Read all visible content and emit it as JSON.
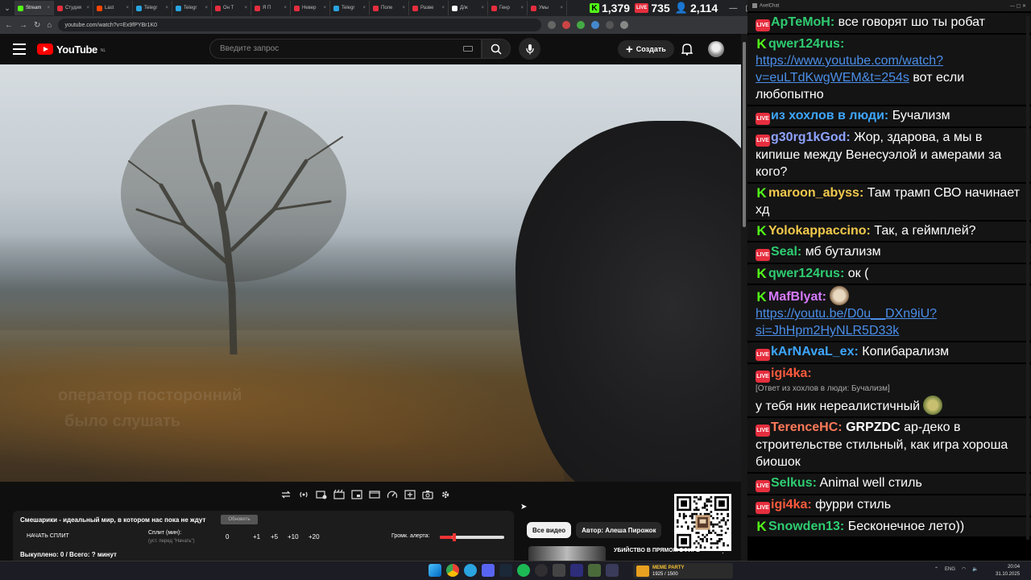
{
  "browser": {
    "tabs": [
      {
        "label": "Stream",
        "color": "#53fc18"
      },
      {
        "label": "Студия",
        "color": "#e62e3e"
      },
      {
        "label": "Last",
        "color": "#ff4500"
      },
      {
        "label": "Telegr",
        "color": "#2aa4e0"
      },
      {
        "label": "Telegr",
        "color": "#2aa4e0"
      },
      {
        "label": "Он Т",
        "color": "#e62e3e"
      },
      {
        "label": "Я П",
        "color": "#e62e3e"
      },
      {
        "label": "Невер",
        "color": "#e62e3e"
      },
      {
        "label": "Telegr",
        "color": "#2aa4e0"
      },
      {
        "label": "Поле",
        "color": "#e62e3e"
      },
      {
        "label": "Разве",
        "color": "#e62e3e"
      },
      {
        "label": "Д/ж",
        "color": "#ffffff"
      },
      {
        "label": "Генр",
        "color": "#e62e3e"
      },
      {
        "label": "Умы",
        "color": "#e62e3e"
      }
    ],
    "url": "youtube.com/watch?v=Ex9fPYBr1K0"
  },
  "stats": {
    "kick_viewers": "1,379",
    "youtube_viewers": "735",
    "total_viewers": "2,114"
  },
  "youtube": {
    "region": "NL",
    "logo": "YouTube",
    "search_placeholder": "Введите запрос",
    "create_label": "Создать"
  },
  "panel": {
    "title": "Смешарики - идеальный мир, в котором нас пока не ждут",
    "refresh": "Обновить",
    "start_split": "НАЧАТЬ СПЛИТ",
    "split_label": "Сплит (мин):",
    "split_hint": "(уст. перед \"Начать\")",
    "split_value": "0",
    "increments": [
      "+1",
      "+5",
      "+10",
      "+20"
    ],
    "alert_volume_label": "Громк. алерта:",
    "alert_volume": 0.2,
    "bought": "Выкуплено: 0 / Всего: ? минут"
  },
  "video_overlay": {
    "line1": "оператор посторонний",
    "line2": "было слушать"
  },
  "filters": {
    "all": "Все видео",
    "author": "Автор: Алеша Пирожок"
  },
  "recommendation": {
    "title": "УБИЙСТВО В ПРЯМОМ ЭФИРЕ"
  },
  "chat": {
    "window_title": "AxelChat",
    "messages": [
      {
        "src": "yt",
        "nick": "АрТеМоН:",
        "color": "#2ecc71",
        "text": "все говорят шо ты робат"
      },
      {
        "src": "kick",
        "nick": "qwer124rus:",
        "color": "#2ecc71",
        "link": "https://www.youtube.com/watch?v=euLTdKwgWEM&t=254s",
        "text": "вот если любопытно"
      },
      {
        "src": "yt",
        "nick": "из хохлов в люди:",
        "color": "#3ea6ff",
        "text": "Бучализм"
      },
      {
        "src": "yt",
        "nick": "g30rg1kGod:",
        "color": "#8fa3ff",
        "text": "Жор, здарова, а мы в кипише между Венесуэлой и амерами за кого?"
      },
      {
        "src": "kick",
        "nick": "maroon_abyss:",
        "color": "#f2c94c",
        "text": "Там трамп СВО начинает хд"
      },
      {
        "src": "kick",
        "nick": "Yolokappaccino:",
        "color": "#f2c94c",
        "text": "Так, а геймплей?"
      },
      {
        "src": "yt",
        "nick": "Seal:",
        "color": "#2ecc71",
        "text": "мб бутализм"
      },
      {
        "src": "kick",
        "nick": "qwer124rus:",
        "color": "#2ecc71",
        "text": "ок ("
      },
      {
        "src": "kick",
        "nick": "MafBlyat:",
        "color": "#d67aff",
        "link": "https://youtu.be/D0u__DXn9iU?si=JhHpm2HyNLR5D33k",
        "text": ""
      },
      {
        "src": "yt",
        "nick": "kArNAvaL_ex:",
        "color": "#3ea6ff",
        "text": "Копибарализм"
      },
      {
        "src": "yt",
        "nick": "igi4ka:",
        "color": "#ff5a3c",
        "reply": "[Ответ из хохлов в люди: Бучализм]",
        "text": "у тебя ник нереалистичный"
      },
      {
        "src": "yt",
        "nick": "TerenceHC:",
        "color": "#ff7a59",
        "bold": "GRPZDC",
        "text": "ар-деко в строительстве стильный, как игра хороша биошок"
      },
      {
        "src": "yt",
        "nick": "Selkus:",
        "color": "#2ecc71",
        "text": "Animal well стиль"
      },
      {
        "src": "yt",
        "nick": "igi4ka:",
        "color": "#ff5a3c",
        "text": "фурри стиль"
      },
      {
        "src": "kick",
        "nick": "Snowden13:",
        "color": "#2ecc71",
        "text": "Бесконечное лето))"
      }
    ]
  },
  "taskbar": {
    "media_title": "MEME PARTY",
    "media_sub": "1925 / 1500",
    "lang": "ENG",
    "time": "20:04",
    "date": "31.10.2025"
  }
}
